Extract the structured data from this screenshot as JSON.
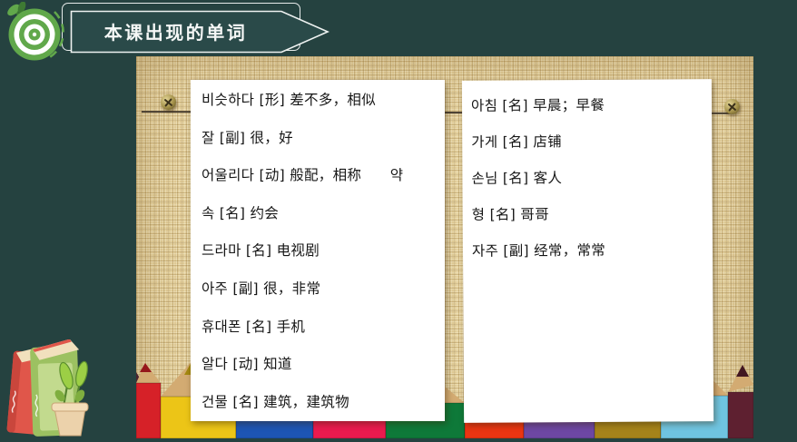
{
  "slide": {
    "title": "本课出现的单词"
  },
  "colors": {
    "slide_bg": "#254240",
    "burlap": "#e0cb96",
    "banner_fill": "#2a4a49",
    "banner_stroke": "#eef2f1",
    "logo_green": "#61a84b",
    "logo_dark_green": "#3e7a33"
  },
  "vocab": {
    "left": [
      "비슷하다 [形] 差不多，相似",
      "잘 [副] 很，好",
      "어울리다 [动] 般配，相称　　약",
      "속 [名] 约会",
      "드라마 [名] 电视剧",
      "아주 [副] 很，非常",
      "휴대폰 [名] 手机",
      "알다 [动] 知道",
      "건물 [名] 建筑，建筑物"
    ],
    "right": [
      "아침 [名] 早晨；早餐",
      "가게 [名] 店铺",
      "손님 [名] 客人",
      "형 [名] 哥哥",
      "자주 [副] 经常，常常"
    ]
  },
  "photo": {
    "pencil_wood": "#d3ab72",
    "pencils": [
      "#d62128",
      "#ecc517",
      "#1d55b4",
      "#ea1a4e",
      "#0e7939",
      "#ea3512",
      "#6d47a3",
      "#a5831a",
      "#6fc4e0",
      "#5e2030",
      "#4a2430"
    ]
  },
  "books": {
    "red_book": "#e0564a",
    "red_spine": "#c9463c",
    "green_book": "#9cc161",
    "green_panel": "#c2da8e",
    "pages": "#f1e0bd",
    "pot": "#ecd2ab",
    "pot_rim": "#f3deba",
    "soil": "#6b4a2a",
    "leaf": "#9ccf45",
    "leaf_dark": "#7fae3f",
    "stem": "#55842f"
  }
}
